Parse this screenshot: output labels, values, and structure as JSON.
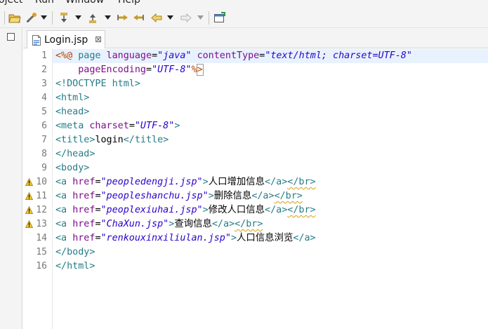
{
  "menubar": {
    "items": [
      "oject",
      "Run",
      "Window",
      "Help"
    ]
  },
  "toolbar": {
    "icons": [
      "open-folder-icon",
      "run-icon",
      "next-annotation-icon",
      "previous-annotation-icon",
      "last-edit-icon",
      "back-icon",
      "forward-icon",
      "open-console-icon"
    ]
  },
  "editor_tab": {
    "title": "Login.jsp",
    "close_glyph": "⊠"
  },
  "editor": {
    "line_numbers": [
      "1",
      "2",
      "3",
      "4",
      "5",
      "6",
      "7",
      "8",
      "9",
      "10",
      "11",
      "12",
      "13",
      "14",
      "15",
      "16"
    ],
    "warning_lines": [
      "10",
      "11",
      "12",
      "13"
    ],
    "lines": [
      [
        {
          "c": "jsp",
          "t": "<%@ "
        },
        {
          "c": "tag",
          "t": "page "
        },
        {
          "c": "attr",
          "t": "language"
        },
        {
          "c": "txt",
          "t": "="
        },
        {
          "c": "val",
          "t": "\"java\" "
        },
        {
          "c": "attr",
          "t": "contentType"
        },
        {
          "c": "txt",
          "t": "="
        },
        {
          "c": "val",
          "t": "\"text/html; charset=UTF-8\""
        }
      ],
      [
        {
          "c": "txt",
          "t": "    "
        },
        {
          "c": "attr",
          "t": "pageEncoding"
        },
        {
          "c": "txt",
          "t": "="
        },
        {
          "c": "val",
          "t": "\"UTF-8\""
        },
        {
          "c": "jsp",
          "t": "%>"
        }
      ],
      [
        {
          "c": "doct",
          "t": "<!DOCTYPE "
        },
        {
          "c": "tag",
          "t": "html"
        },
        {
          "c": "doct",
          "t": ">"
        }
      ],
      [
        {
          "c": "tag",
          "t": "<html>"
        }
      ],
      [
        {
          "c": "tag",
          "t": "<head>"
        }
      ],
      [
        {
          "c": "tag",
          "t": "<meta "
        },
        {
          "c": "attr",
          "t": "charset"
        },
        {
          "c": "txt",
          "t": "="
        },
        {
          "c": "val",
          "t": "\"UTF-8\""
        },
        {
          "c": "tag",
          "t": ">"
        }
      ],
      [
        {
          "c": "tag",
          "t": "<title>"
        },
        {
          "c": "txt",
          "t": "login"
        },
        {
          "c": "tag",
          "t": "</title>"
        }
      ],
      [
        {
          "c": "tag",
          "t": "</head>"
        }
      ],
      [
        {
          "c": "tag",
          "t": "<body>"
        }
      ],
      [
        {
          "c": "tag",
          "t": "<a "
        },
        {
          "c": "attr",
          "t": "href"
        },
        {
          "c": "txt",
          "t": "="
        },
        {
          "c": "val",
          "t": "\"peopledengji.jsp\""
        },
        {
          "c": "tag",
          "t": ">"
        },
        {
          "c": "txt",
          "t": "人口增加信息"
        },
        {
          "c": "tag",
          "t": "</a>"
        },
        {
          "c": "tag squig",
          "t": "</br>"
        }
      ],
      [
        {
          "c": "tag",
          "t": "<a "
        },
        {
          "c": "attr",
          "t": "href"
        },
        {
          "c": "txt",
          "t": "="
        },
        {
          "c": "val",
          "t": "\"peopleshanchu.jsp\""
        },
        {
          "c": "tag",
          "t": ">"
        },
        {
          "c": "txt",
          "t": "删除信息"
        },
        {
          "c": "tag",
          "t": "</a>"
        },
        {
          "c": "tag squig",
          "t": "</br>"
        }
      ],
      [
        {
          "c": "tag",
          "t": "<a "
        },
        {
          "c": "attr",
          "t": "href"
        },
        {
          "c": "txt",
          "t": "="
        },
        {
          "c": "val",
          "t": "\"peoplexiuhai.jsp\""
        },
        {
          "c": "tag",
          "t": ">"
        },
        {
          "c": "txt",
          "t": "修改人口信息"
        },
        {
          "c": "tag",
          "t": "</a>"
        },
        {
          "c": "tag squig",
          "t": "</br>"
        }
      ],
      [
        {
          "c": "tag",
          "t": "<a "
        },
        {
          "c": "attr",
          "t": "href"
        },
        {
          "c": "txt",
          "t": "="
        },
        {
          "c": "val",
          "t": "\"ChaXun.jsp\""
        },
        {
          "c": "tag",
          "t": ">"
        },
        {
          "c": "txt",
          "t": "查询信息"
        },
        {
          "c": "tag",
          "t": "</a>"
        },
        {
          "c": "tag squig",
          "t": "</br>"
        }
      ],
      [
        {
          "c": "tag",
          "t": "<a "
        },
        {
          "c": "attr",
          "t": "href"
        },
        {
          "c": "txt",
          "t": "="
        },
        {
          "c": "val",
          "t": "\"renkouxinxiliulan.jsp\""
        },
        {
          "c": "tag",
          "t": ">"
        },
        {
          "c": "txt",
          "t": "人口信息浏览"
        },
        {
          "c": "tag",
          "t": "</a>"
        }
      ],
      [
        {
          "c": "tag",
          "t": "</body>"
        }
      ],
      [
        {
          "c": "tag",
          "t": "</html>"
        }
      ]
    ]
  }
}
